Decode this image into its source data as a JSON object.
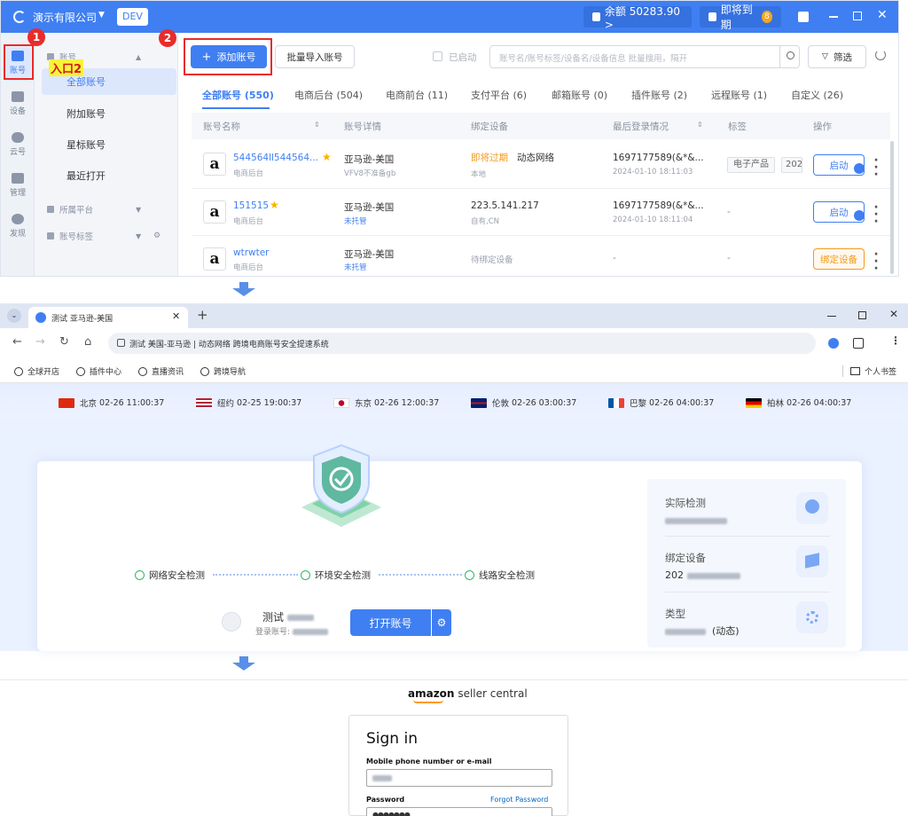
{
  "app": {
    "company": "演示有限公司",
    "env": "DEV",
    "balance": "余额 50283.90 >",
    "expiring": "即将到期",
    "expiring_count": "8"
  },
  "leftnav": [
    {
      "label": "账号"
    },
    {
      "label": "设备"
    },
    {
      "label": "云号"
    },
    {
      "label": "管理"
    },
    {
      "label": "发现"
    }
  ],
  "subnav": {
    "group1": "账号",
    "items": [
      "全部账号",
      "附加账号",
      "星标账号",
      "最近打开"
    ],
    "group2": "所属平台",
    "group3": "账号标签"
  },
  "annotations": {
    "step1": "1",
    "step2": "2",
    "entry_label": "入口2"
  },
  "toolbar": {
    "add_account": "添加账号",
    "batch_import": "批量导入账号",
    "enabled_label": "已启动",
    "search_placeholder": "账号名/账号标签/设备名/设备信息 批量搜用，隔开",
    "filter": "筛选"
  },
  "tabs": [
    "全部账号 (550)",
    "电商后台 (504)",
    "电商前台 (11)",
    "支付平台 (6)",
    "邮箱账号 (0)",
    "插件账号 (2)",
    "远程账号 (1)",
    "自定义 (26)"
  ],
  "columns": [
    "账号名称",
    "账号详情",
    "绑定设备",
    "最后登录情况",
    "标签",
    "操作"
  ],
  "rows": [
    {
      "name": "544564ll544564...",
      "sub": "电商后台",
      "detail": "亚马逊-美国",
      "detail_sub": "VFV8不准备gb",
      "device_status": "即将过期",
      "device": "动态网络",
      "device_sub": "本地",
      "login": "1697177589(&*&...",
      "login_time": "2024-01-10 18:11:03",
      "tags": [
        "电子产品",
        "202"
      ],
      "action": "启动"
    },
    {
      "name": "151515",
      "sub": "电商后台",
      "detail": "亚马逊-美国",
      "detail_sub": "未托管",
      "device": "223.5.141.217",
      "device_sub": "自有,CN",
      "login": "1697177589(&*&...",
      "login_time": "2024-01-10 18:11:04",
      "tags_text": "-",
      "action": "启动"
    },
    {
      "name": "wtrwter",
      "sub": "电商后台",
      "detail": "亚马逊-美国",
      "detail_sub": "未托管",
      "device": "待绑定设备",
      "login": "-",
      "tags_text": "-",
      "action": "绑定设备"
    }
  ],
  "browser": {
    "tab_title": "测试 亚马逊-美国",
    "address": "测试 美国-亚马逊 | 动态网络   跨境电商账号安全提速系统",
    "bookmarks": [
      "全球开店",
      "插件中心",
      "直播资讯",
      "跨境导航"
    ],
    "bookmark_folder": "个人书签"
  },
  "clocks": [
    {
      "city": "北京",
      "time": "02-26 11:00:37",
      "colors": [
        "#de2910",
        "#ffde00"
      ]
    },
    {
      "city": "纽约",
      "time": "02-25 19:00:37",
      "colors": [
        "#b22234",
        "#3c3b6e"
      ]
    },
    {
      "city": "东京",
      "time": "02-26 12:00:37",
      "colors": [
        "#ffffff",
        "#bc002d"
      ]
    },
    {
      "city": "伦敦",
      "time": "02-26 03:00:37",
      "colors": [
        "#012169",
        "#c8102e"
      ]
    },
    {
      "city": "巴黎",
      "time": "02-26 04:00:37",
      "colors": [
        "#0055a4",
        "#ef4135"
      ]
    },
    {
      "city": "柏林",
      "time": "02-26 04:00:37",
      "colors": [
        "#000000",
        "#dd0000"
      ]
    }
  ],
  "checks": [
    "网络安全检测",
    "环境安全检测",
    "线路安全检测"
  ],
  "launch": {
    "account_name": "测试",
    "login_label": "登录账号:",
    "open_button": "打开账号"
  },
  "right_panel": {
    "real_check": "实际检测",
    "bound_device": "绑定设备",
    "bound_device_value": "202",
    "type": "类型",
    "type_value": "(动态)"
  },
  "amazon": {
    "logo": "amazon",
    "logo_suffix": "seller central",
    "title": "Sign in",
    "field_label": "Mobile phone number or e-mail",
    "password_label": "Password",
    "forgot": "Forgot Password"
  },
  "colors": {
    "primary": "#3f7ff2",
    "annotation_red": "#e82c2c",
    "warning": "#f39a1c",
    "success": "#30b866"
  }
}
